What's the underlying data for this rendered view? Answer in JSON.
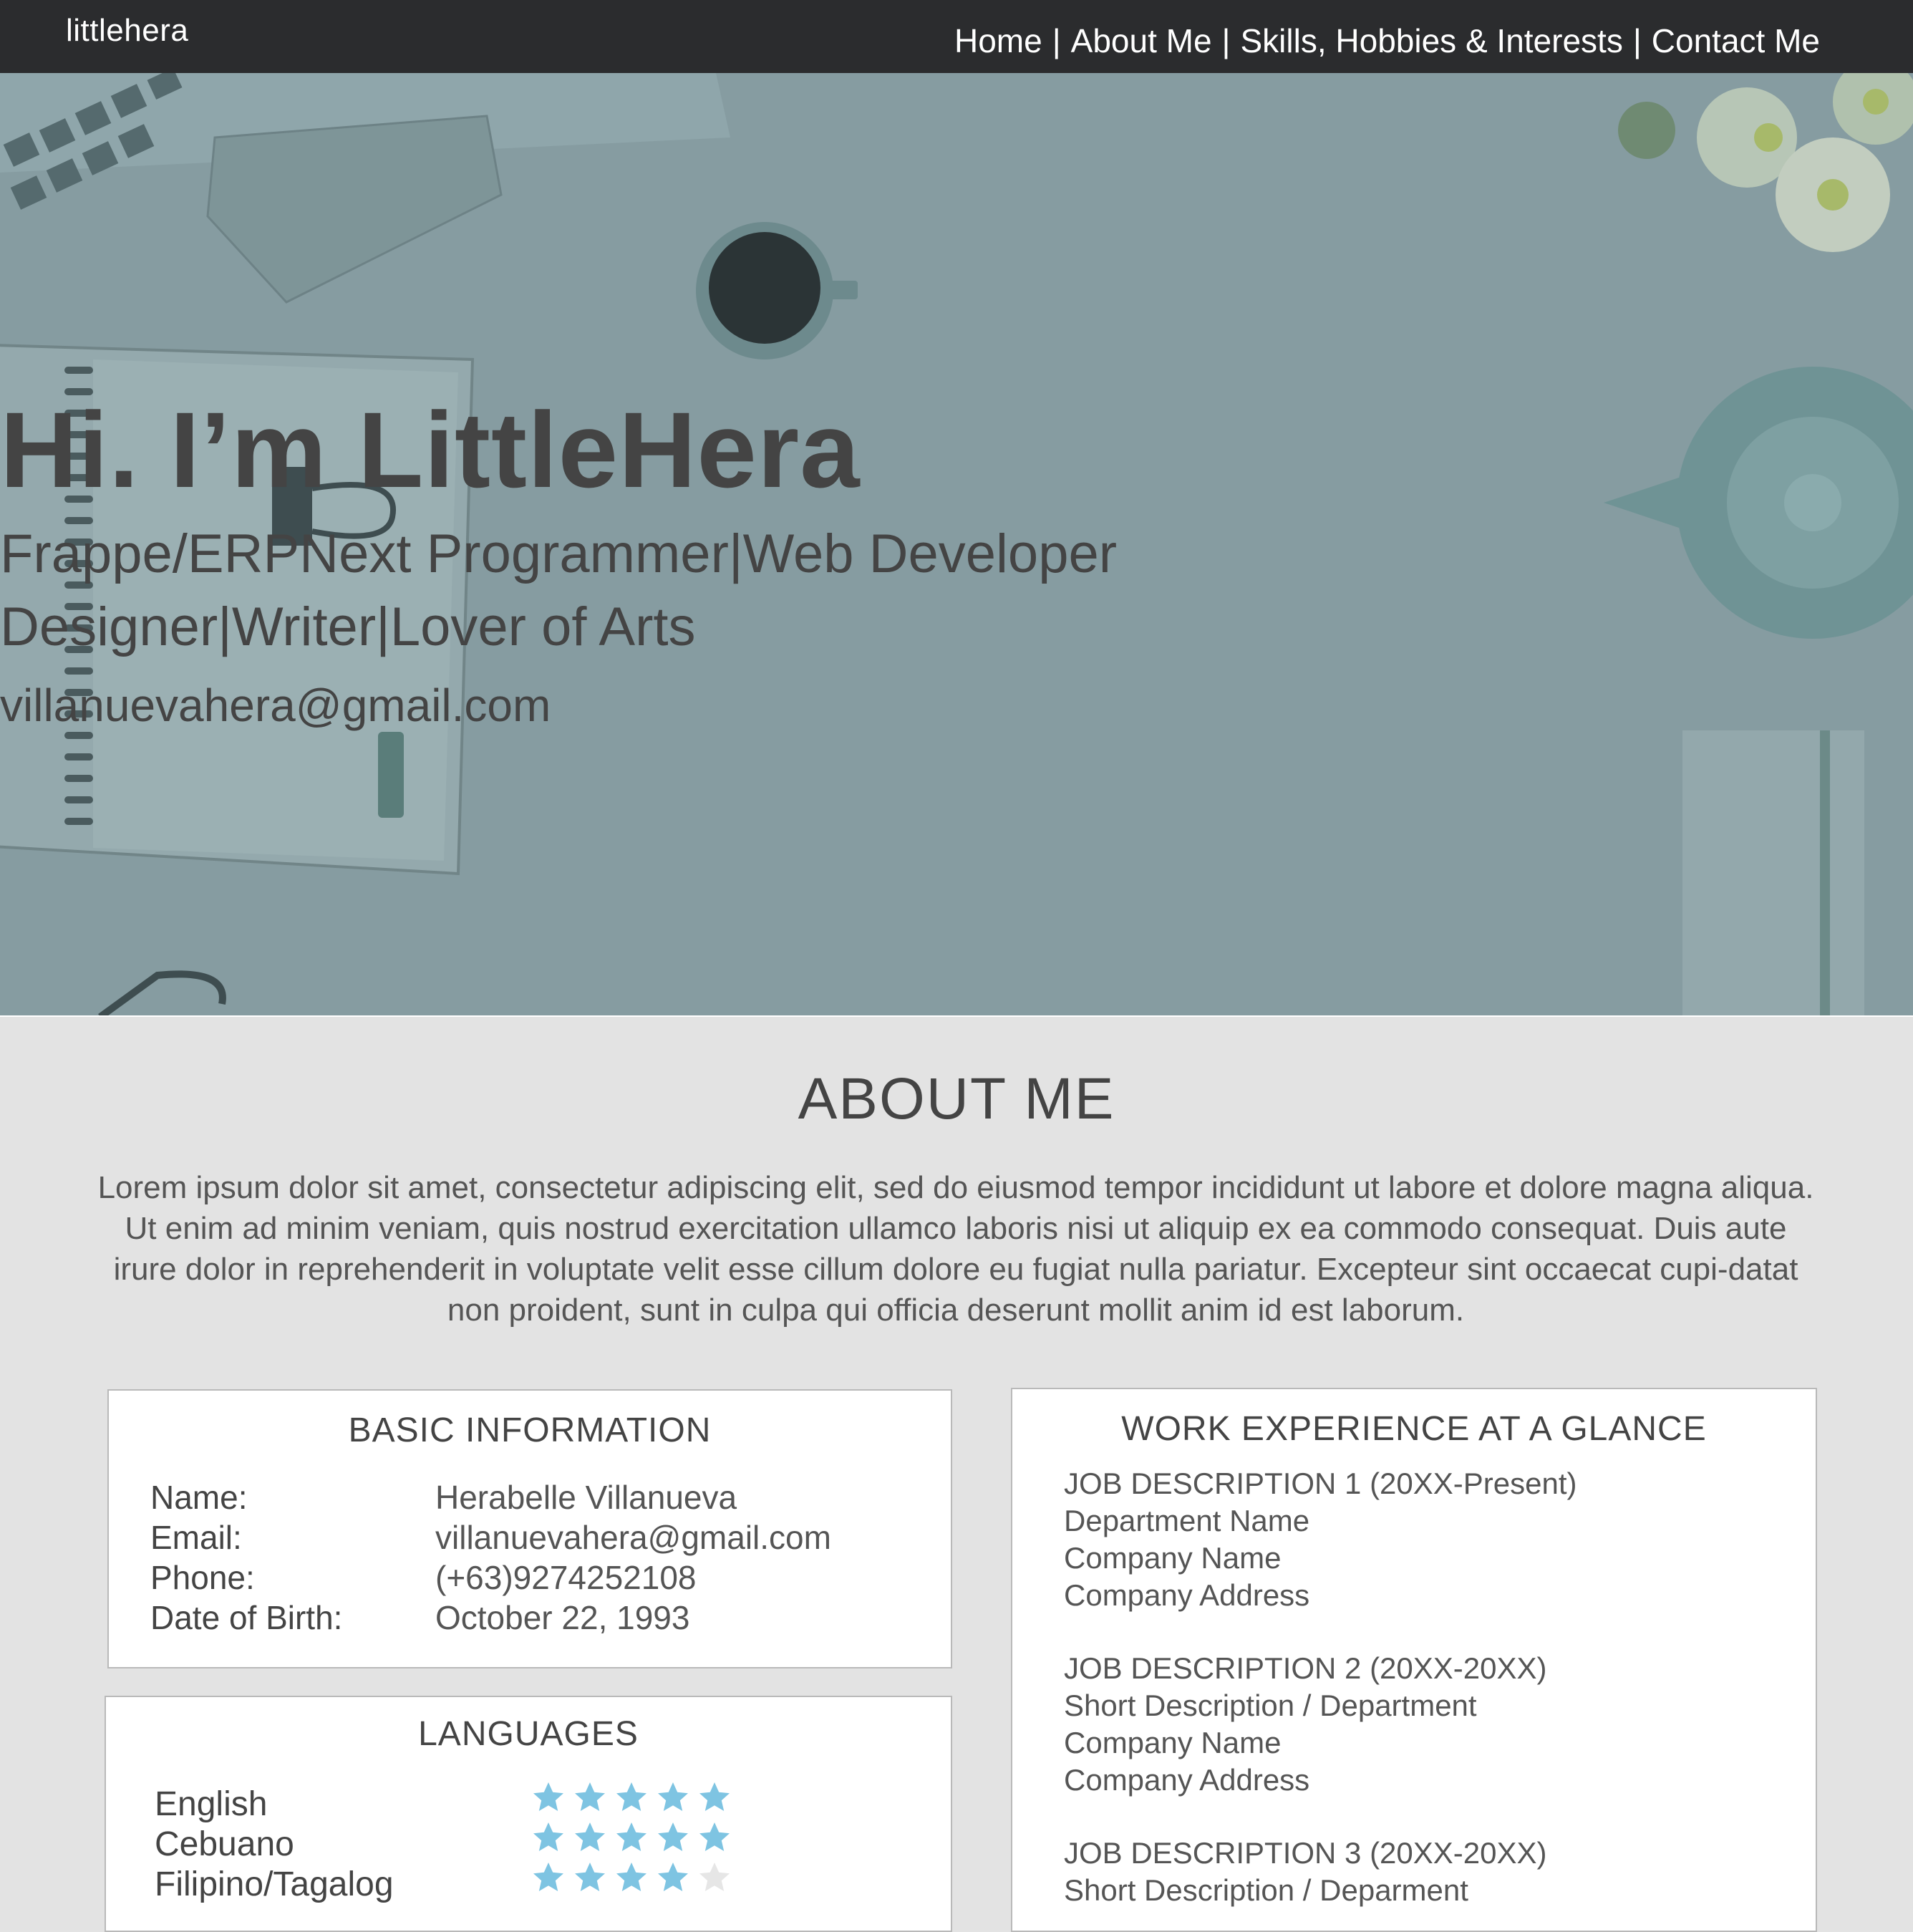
{
  "nav": {
    "brand": "littlehera",
    "items": [
      "Home",
      "About Me",
      "Skills, Hobbies & Interests",
      "Contact Me"
    ]
  },
  "hero": {
    "title": "Hi. I’m LittleHera",
    "subtitle_line1": "Frappe/ERPNext Programmer|Web Developer",
    "subtitle_line2": "Designer|Writer|Lover of Arts",
    "email": "villanuevahera@gmail.com"
  },
  "about": {
    "title": "ABOUT ME",
    "body": "Lorem ipsum dolor sit amet, consectetur adipiscing elit, sed do eiusmod tempor incididunt ut labore et dolore magna aliqua. Ut enim ad minim veniam, quis nostrud exercitation ullamco laboris nisi ut aliquip ex ea commodo consequat. Duis aute irure dolor in reprehenderit in voluptate velit esse cillum dolore eu fugiat nulla pariatur. Excepteur sint occaecat cupi-datat non proident, sunt in culpa qui officia deserunt mollit anim id est laborum."
  },
  "basic_info": {
    "title": "BASIC INFORMATION",
    "rows": [
      {
        "label": "Name:",
        "value": "Herabelle Villanueva"
      },
      {
        "label": "Email:",
        "value": "villanuevahera@gmail.com"
      },
      {
        "label": "Phone:",
        "value": "(+63)9274252108"
      },
      {
        "label": "Date of Birth:",
        "value": "October 22, 1993"
      }
    ]
  },
  "languages": {
    "title": "LANGUAGES",
    "star_color": "#7ec4e2",
    "empty_star_color": "#e6e6e6",
    "items": [
      {
        "name": "English",
        "rating": 5
      },
      {
        "name": "Cebuano",
        "rating": 5
      },
      {
        "name": "Filipino/Tagalog",
        "rating": 4
      }
    ]
  },
  "work": {
    "title": "WORK EXPERIENCE AT A GLANCE",
    "jobs": [
      {
        "lines": [
          "JOB DESCRIPTION 1 (20XX-Present)",
          "Department Name",
          "Company Name",
          "Company Address"
        ]
      },
      {
        "lines": [
          "JOB DESCRIPTION 2 (20XX-20XX)",
          "Short Description / Department",
          "Company Name",
          "Company Address"
        ]
      },
      {
        "lines": [
          "JOB DESCRIPTION 3 (20XX-20XX)",
          "Short Description / Deparment"
        ]
      }
    ]
  }
}
